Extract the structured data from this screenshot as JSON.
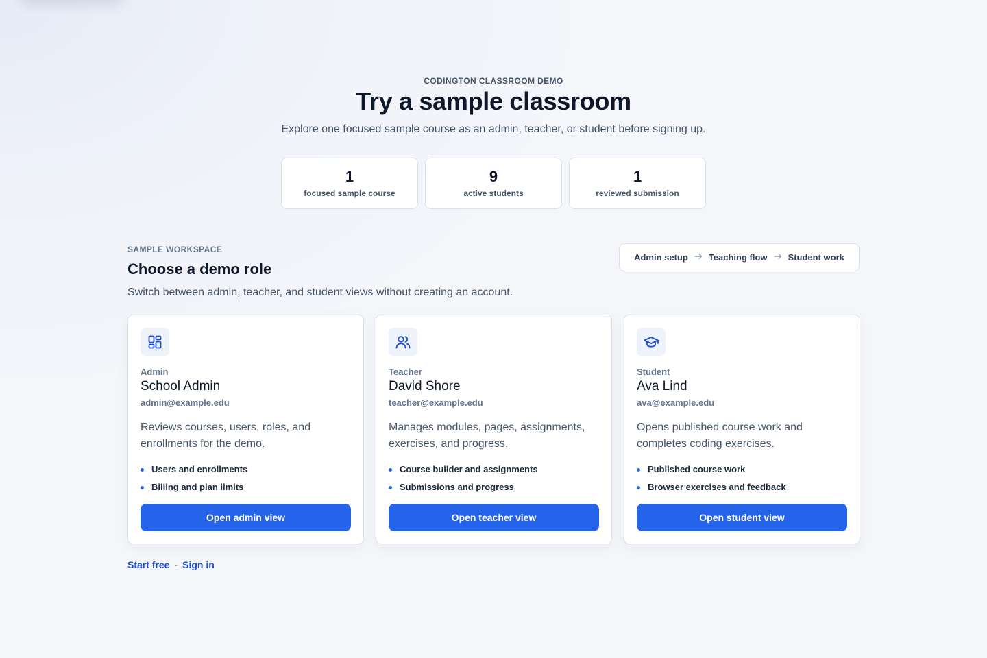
{
  "hero": {
    "eyebrow": "CODINGTON CLASSROOM DEMO",
    "title": "Try a sample classroom",
    "subtitle": "Explore one focused sample course as an admin, teacher, or student before signing up."
  },
  "stats": [
    {
      "value": "1",
      "label": "focused sample course"
    },
    {
      "value": "9",
      "label": "active students"
    },
    {
      "value": "1",
      "label": "reviewed submission"
    }
  ],
  "workspace": {
    "eyebrow": "SAMPLE WORKSPACE",
    "title": "Choose a demo role",
    "subtitle": "Switch between admin, teacher, and student views without creating an account.",
    "flow": [
      "Admin setup",
      "Teaching flow",
      "Student work"
    ]
  },
  "cards": [
    {
      "icon": "dashboard-grid-icon",
      "role": "Admin",
      "name": "School Admin",
      "email": "admin@example.edu",
      "description": "Reviews courses, users, roles, and enrollments for the demo.",
      "features": [
        "Users and enrollments",
        "Billing and plan limits"
      ],
      "button": "Open admin view"
    },
    {
      "icon": "users-icon",
      "role": "Teacher",
      "name": "David Shore",
      "email": "teacher@example.edu",
      "description": "Manages modules, pages, assignments, exercises, and progress.",
      "features": [
        "Course builder and assignments",
        "Submissions and progress"
      ],
      "button": "Open teacher view"
    },
    {
      "icon": "graduation-cap-icon",
      "role": "Student",
      "name": "Ava Lind",
      "email": "ava@example.edu",
      "description": "Opens published course work and completes coding exercises.",
      "features": [
        "Published course work",
        "Browser exercises and feedback"
      ],
      "button": "Open student view"
    }
  ],
  "footer": {
    "start_free": "Start free",
    "separator": "·",
    "sign_in": "Sign in"
  },
  "colors": {
    "accent": "#2563eb",
    "link": "#1d4ed8",
    "heading": "#0f172a",
    "muted": "#475569"
  }
}
